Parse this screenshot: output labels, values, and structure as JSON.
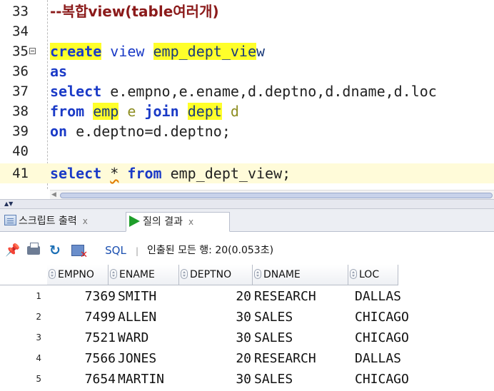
{
  "editor": {
    "lines": [
      {
        "num": "33",
        "text": "--복합view(table여러개)"
      },
      {
        "num": "34",
        "text": ""
      },
      {
        "num": "35",
        "kw": "create",
        "rest1": " view ",
        "hl": "emp_dept_vie",
        "rest2": "w"
      },
      {
        "num": "36",
        "text": "as"
      },
      {
        "num": "37",
        "kw": "select",
        "rest": " e.empno,e.ename,d.deptno,d.dname,d.loc"
      },
      {
        "num": "38",
        "kw": "from",
        "t1": "emp",
        "t2": " e ",
        "kw2": "join",
        "t3": "dept",
        "t4": " d"
      },
      {
        "num": "39",
        "kw": "on",
        "rest": " e.deptno=d.deptno;"
      },
      {
        "num": "40",
        "text": ""
      },
      {
        "num": "41",
        "kw": "select",
        "star": "*",
        "kw2": "from",
        "rest": " emp_dept_view;"
      }
    ]
  },
  "tabs": [
    {
      "label": "스크립트 출력",
      "close": "x"
    },
    {
      "label": "질의 결과",
      "close": "x"
    }
  ],
  "toolbar": {
    "sql_label": "SQL",
    "separator": "|",
    "status": "인출된 모든 행: 20(0.053초)"
  },
  "grid": {
    "columns": [
      "EMPNO",
      "ENAME",
      "DEPTNO",
      "DNAME",
      "LOC"
    ],
    "rows": [
      {
        "rn": "1",
        "empno": "7369",
        "ename": "SMITH",
        "deptno": "20",
        "dname": "RESEARCH",
        "loc": "DALLAS"
      },
      {
        "rn": "2",
        "empno": "7499",
        "ename": "ALLEN",
        "deptno": "30",
        "dname": "SALES",
        "loc": "CHICAGO"
      },
      {
        "rn": "3",
        "empno": "7521",
        "ename": "WARD",
        "deptno": "30",
        "dname": "SALES",
        "loc": "CHICAGO"
      },
      {
        "rn": "4",
        "empno": "7566",
        "ename": "JONES",
        "deptno": "20",
        "dname": "RESEARCH",
        "loc": "DALLAS"
      },
      {
        "rn": "5",
        "empno": "7654",
        "ename": "MARTIN",
        "deptno": "30",
        "dname": "SALES",
        "loc": "CHICAGO"
      }
    ]
  },
  "icons": {
    "fold": "fold-collapse-icon",
    "pin": "pin-icon",
    "print": "print-icon",
    "refresh": "refresh-icon",
    "cancel": "cancel-query-icon",
    "script_output": "document-icon",
    "query_result": "play-icon",
    "sort": "sort-icon"
  },
  "colors": {
    "keyword": "#1a3ac7",
    "comment": "#8b1a1a",
    "highlight": "#ffff2a",
    "current_line": "#fffbd9",
    "run_green": "#1e9e2a"
  }
}
